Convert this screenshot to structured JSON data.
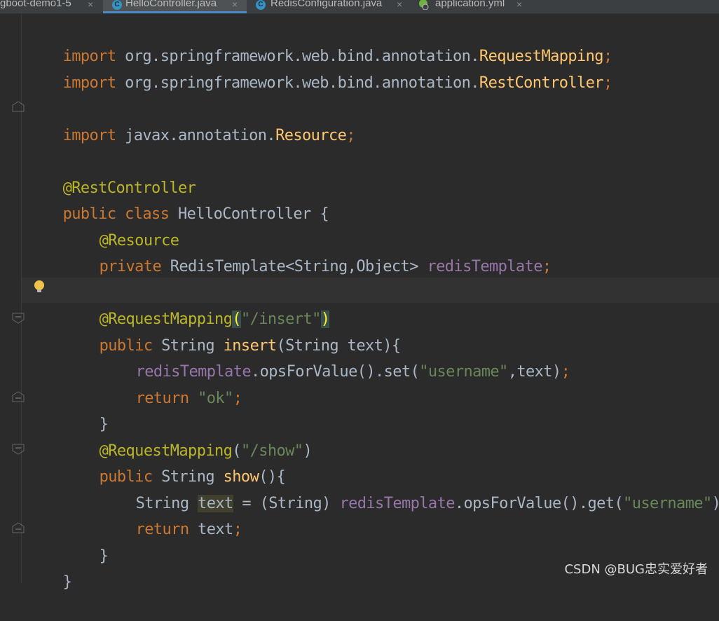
{
  "tabs": [
    {
      "name": "gboot-demo1-5",
      "icon": "none",
      "active": false
    },
    {
      "name": "HelloController.java",
      "icon": "java-class-icon",
      "active": true
    },
    {
      "name": "RedisConfiguration.java",
      "icon": "java-class-icon",
      "active": false
    },
    {
      "name": "application.yml",
      "icon": "spring-yml-icon",
      "active": false
    }
  ],
  "close_glyph": "×",
  "class_icon_letter": "C",
  "code": {
    "l1_kw": "import",
    "l1_pkg": " org.springframework.web.bind.annotation.",
    "l1_cls": "RequestMapping",
    "l2_kw": "import",
    "l2_pkg": " org.springframework.web.bind.annotation.",
    "l2_cls": "RestController",
    "l3_kw": "import",
    "l3_pkg": " javax.annotation.",
    "l3_cls": "Resource",
    "semi": ";",
    "ann_restcontroller": "@RestController",
    "kw_public": "public",
    "kw_class": "class",
    "class_name": " HelloController {",
    "ann_resource": "@Resource",
    "kw_private": "private",
    "field_type": " RedisTemplate<String,Object> ",
    "field_name": "redisTemplate",
    "ann_requestmapping": "@RequestMapping",
    "paren_open": "(",
    "paren_close": ")",
    "path_insert": "\"/insert\"",
    "path_show": "\"/show\"",
    "string_type": " String ",
    "m_insert": "insert",
    "insert_params": "(String text){",
    "ops_set": ".opsForValue().set(",
    "str_username": "\"username\"",
    "set_tail": ",text)",
    "kw_return": "return",
    "str_ok": "\"ok\"",
    "close_brace": "}",
    "m_show": "show",
    "show_params": "(){",
    "string_decl": "String ",
    "var_text": "text",
    "assign_cast": " = (String) ",
    "ops_get": ".opsForValue().get(",
    "return_text": " text"
  },
  "watermark": "CSDN @BUG忠实爱好者",
  "colors": {
    "background": "#2b2b2b",
    "keyword": "#cc7832",
    "annotation": "#bbb529",
    "string": "#6a8759",
    "field": "#9876aa",
    "method": "#ffc66d",
    "text": "#a9b7c6"
  }
}
